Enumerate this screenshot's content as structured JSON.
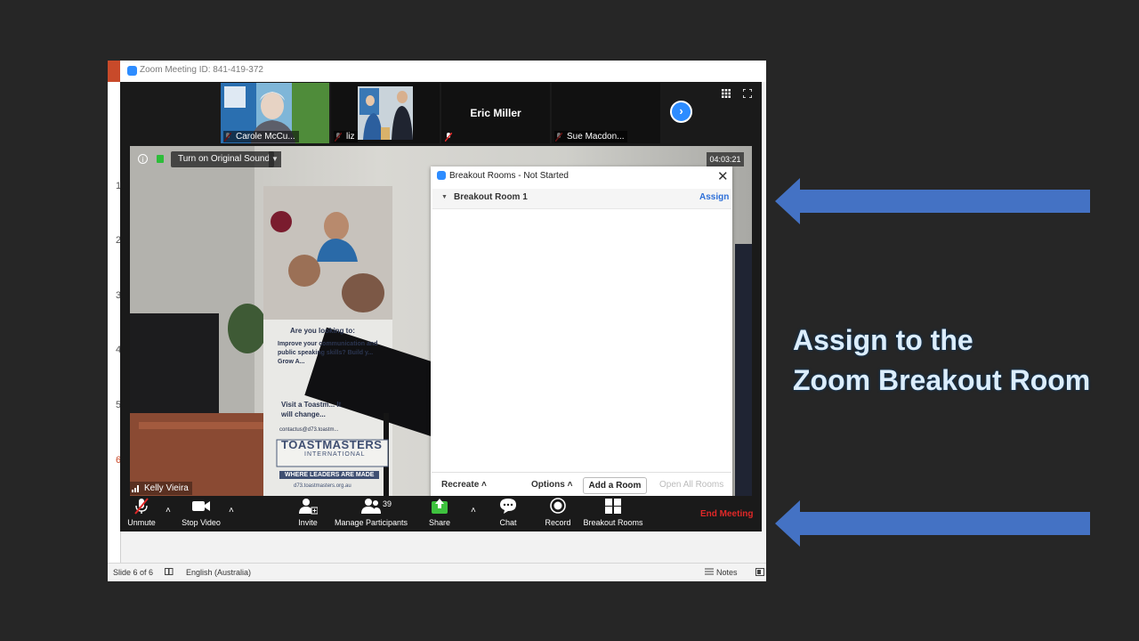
{
  "zoom": {
    "window_title": "Zoom Meeting ID: 841-419-372",
    "thumbnails": [
      {
        "name": "Carole McCu..."
      },
      {
        "name": "liz"
      },
      {
        "name": "Eric Miller"
      },
      {
        "name": "Sue Macdon..."
      }
    ],
    "original_sound_label": "Turn on Original Sound",
    "timer": "04:03:21",
    "speaker_name": "Kelly Vieira",
    "video_text": {
      "headline": "Are you looking to:",
      "body": "Improve your communication and public speaking skills? Build y... Grow A...",
      "visit": "Visit a Toastm... It will change...",
      "contact": "contactus@d73.toastm...",
      "brand": "TOASTMASTERS",
      "brand_sub": "INTERNATIONAL",
      "tagline": "WHERE LEADERS ARE MADE",
      "site": "d73.toastmasters.org.au"
    },
    "breakout": {
      "title": "Breakout Rooms - Not Started",
      "room": "Breakout Room 1",
      "assign": "Assign",
      "recreate": "Recreate",
      "options": "Options",
      "add_room": "Add a Room",
      "open_all": "Open All Rooms"
    },
    "toolbar": {
      "unmute": "Unmute",
      "stop_video": "Stop Video",
      "invite": "Invite",
      "manage_participants": "Manage Participants",
      "participant_count": "39",
      "share": "Share",
      "chat": "Chat",
      "record": "Record",
      "breakout_rooms": "Breakout Rooms",
      "end_meeting": "End Meeting"
    }
  },
  "powerpoint": {
    "slide_numbers": [
      "1",
      "2",
      "3",
      "4",
      "5",
      "6"
    ],
    "status_slide": "Slide 6 of 6",
    "status_language": "English (Australia)",
    "status_notes": "Notes"
  },
  "annotation": {
    "line1": "Assign to the",
    "line2": "Zoom Breakout Room",
    "arrow_color": "#4472c4"
  }
}
